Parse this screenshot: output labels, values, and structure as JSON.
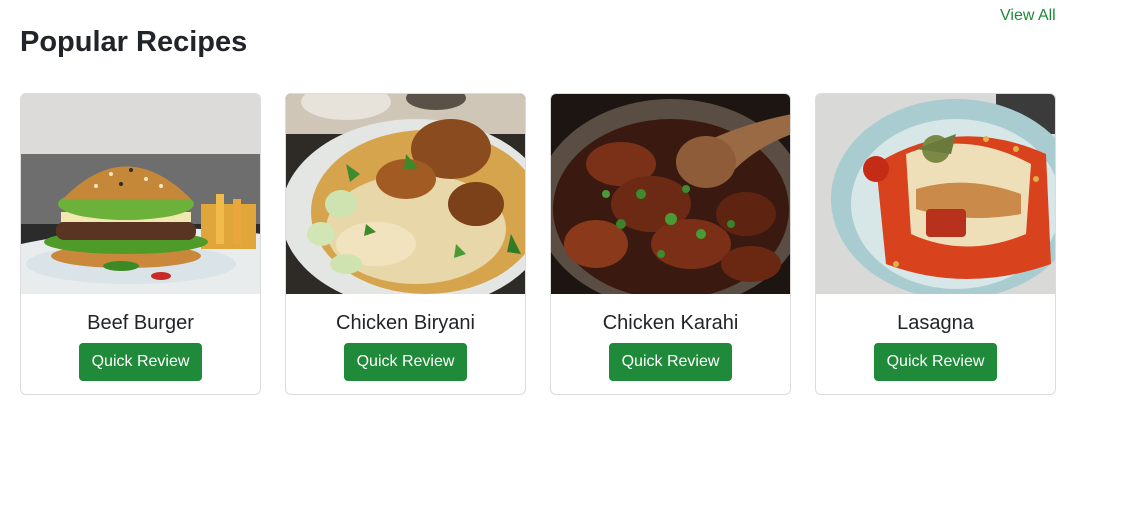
{
  "header": {
    "title": "Popular Recipes",
    "view_all": "View All"
  },
  "colors": {
    "accent": "#1e8a3a",
    "card_border": "#dcdcdc"
  },
  "recipes": [
    {
      "name": "Beef Burger",
      "button": "Quick Review",
      "image": "beef-burger-photo"
    },
    {
      "name": "Chicken Biryani",
      "button": "Quick Review",
      "image": "chicken-biryani-photo"
    },
    {
      "name": "Chicken Karahi",
      "button": "Quick Review",
      "image": "chicken-karahi-photo"
    },
    {
      "name": "Lasagna",
      "button": "Quick Review",
      "image": "lasagna-photo"
    }
  ]
}
